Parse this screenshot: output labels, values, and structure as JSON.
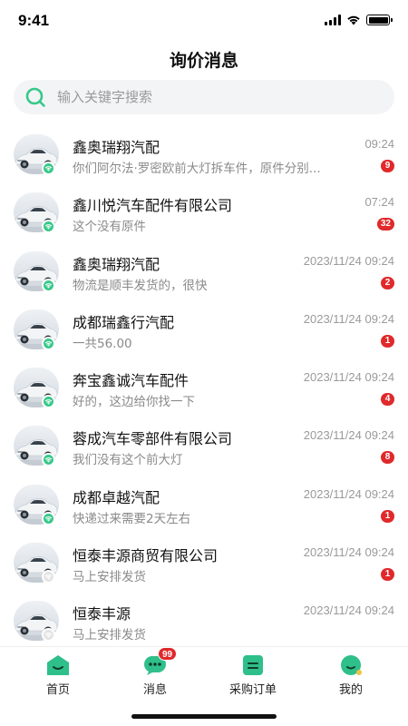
{
  "status_bar": {
    "time": "9:41"
  },
  "header": {
    "title": "询价消息"
  },
  "search": {
    "placeholder": "输入关键字搜索"
  },
  "colors": {
    "accent": "#38c88a",
    "badge": "#e0292b"
  },
  "conversations": [
    {
      "name": "鑫奥瑞翔汽配",
      "time": "09:24",
      "message": "你们阿尔法·罗密欧前大灯拆车件，原件分别...",
      "badge": "9",
      "online": true
    },
    {
      "name": "鑫川悦汽车配件有限公司",
      "time": "07:24",
      "message": "这个没有原件",
      "badge": "32",
      "online": true
    },
    {
      "name": "鑫奥瑞翔汽配",
      "time": "2023/11/24 09:24",
      "message": "物流是顺丰发货的，很快",
      "badge": "2",
      "online": true
    },
    {
      "name": "成都瑞鑫行汽配",
      "time": "2023/11/24 09:24",
      "message": "一共56.00",
      "badge": "1",
      "online": true
    },
    {
      "name": "奔宝鑫诚汽车配件",
      "time": "2023/11/24 09:24",
      "message": "好的，这边给你找一下",
      "badge": "4",
      "online": true
    },
    {
      "name": "蓉成汽车零部件有限公司",
      "time": "2023/11/24 09:24",
      "message": "我们没有这个前大灯",
      "badge": "8",
      "online": true
    },
    {
      "name": "成都卓越汽配",
      "time": "2023/11/24 09:24",
      "message": "快递过来需要2天左右",
      "badge": "1",
      "online": true
    },
    {
      "name": "恒泰丰源商贸有限公司",
      "time": "2023/11/24 09:24",
      "message": "马上安排发货",
      "badge": "1",
      "online": false
    },
    {
      "name": "恒泰丰源",
      "time": "2023/11/24 09:24",
      "message": "马上安排发货",
      "badge": "",
      "online": false
    }
  ],
  "tabs": [
    {
      "label": "首页",
      "icon": "home-icon",
      "badge": ""
    },
    {
      "label": "消息",
      "icon": "message-icon",
      "badge": "99"
    },
    {
      "label": "采购订单",
      "icon": "order-icon",
      "badge": ""
    },
    {
      "label": "我的",
      "icon": "profile-icon",
      "badge": ""
    }
  ]
}
